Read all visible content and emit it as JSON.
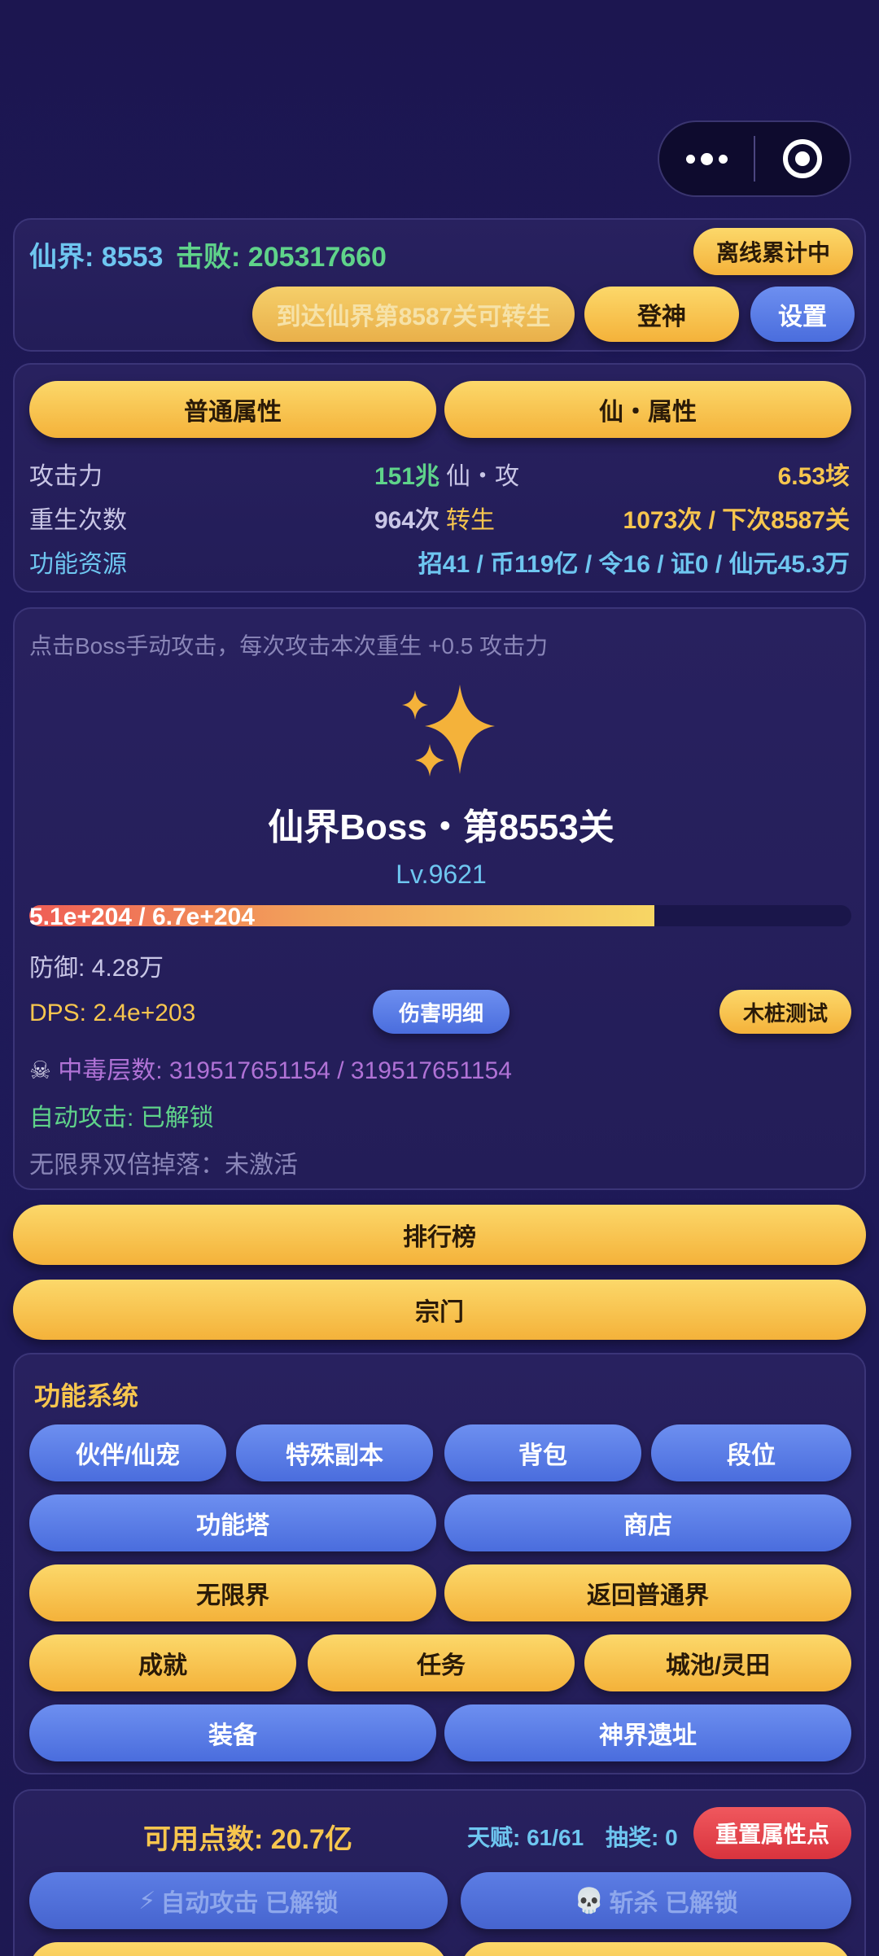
{
  "capsule": {
    "more_icon": "more-dots-icon",
    "close_icon": "target-circle-icon"
  },
  "top": {
    "realm_label": "仙界:",
    "realm_value": "8553",
    "defeat_label": "击败:",
    "defeat_value": "205317660",
    "offline_button": "离线累计中",
    "rebirth_hint": "到达仙界第8587关可转生",
    "ascend_button": "登神",
    "settings_button": "设置"
  },
  "attributes": {
    "tab_normal": "普通属性",
    "tab_immortal": "仙・属性",
    "rows": [
      {
        "label": "攻击力",
        "value": "151兆",
        "label2": "仙・攻",
        "value2": "6.53垓"
      },
      {
        "label": "重生次数",
        "value": "964次",
        "label2": "转生",
        "value2": "1073次 / 下次8587关"
      }
    ],
    "resources_label": "功能资源",
    "resources_value": "招41 / 币119亿 / 令16 / 证0 / 仙元45.3万"
  },
  "boss": {
    "hint": "点击Boss手动攻击，每次攻击本次重生 +0.5 攻击力",
    "icon": "sparkle-stars-icon",
    "name": "仙界Boss・第8553关",
    "level": "Lv.9621",
    "hp_text": "5.1e+204 / 6.7e+204",
    "hp_fraction": 0.76,
    "defense": "防御: 4.28万",
    "dps": "DPS: 2.4e+203",
    "damage_detail_button": "伤害明细",
    "dummy_test_button": "木桩测试",
    "poison_icon": "skull-crossbones-icon",
    "poison": "中毒层数: 319517651154 / 319517651154",
    "auto_attack": "自动攻击: 已解锁",
    "infinite_drop": "无限界双倍掉落：未激活"
  },
  "main_buttons": {
    "ranking": "排行榜",
    "sect": "宗门"
  },
  "systems": {
    "title": "功能系统",
    "row1": [
      "伙伴/仙宠",
      "特殊副本",
      "背包",
      "段位"
    ],
    "row2": [
      "功能塔",
      "商店"
    ],
    "row3": [
      "无限界",
      "返回普通界"
    ],
    "row4": [
      "成就",
      "任务",
      "城池/灵田"
    ],
    "row5": [
      "装备",
      "神界遗址"
    ]
  },
  "points": {
    "available": "可用点数: 20.7亿",
    "talent": "天赋: 61/61",
    "lottery": "抽奖: 0",
    "reset_button": "重置属性点",
    "auto_attack_button": "自动攻击 已解锁",
    "auto_attack_icon": "lightning-icon",
    "kill_button": "斩杀 已解锁",
    "kill_icon": "skull-icon"
  },
  "colors": {
    "gold": "#f4b23a",
    "blue": "#4a6ddd",
    "green": "#5fd38a",
    "cyan": "#6ec6f0",
    "purple": "#b072d6",
    "red": "#d9333d"
  }
}
